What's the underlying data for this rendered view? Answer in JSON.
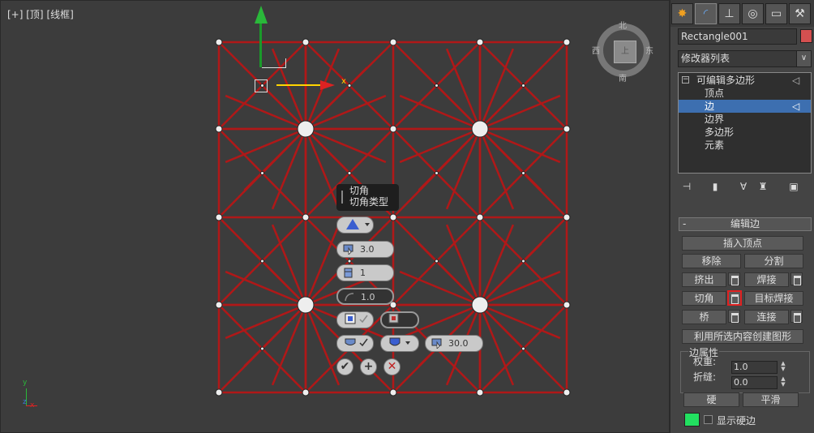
{
  "viewport": {
    "label_plus": "[+]",
    "label_view": "[顶]",
    "label_mode": "[线框]",
    "gizmo_x_label": "x",
    "viewcube": {
      "north": "北",
      "south": "南",
      "east": "东",
      "west": "西",
      "face": "上"
    },
    "tripod": {
      "x": "x",
      "y": "y",
      "z": "z"
    }
  },
  "caddy": {
    "title": "切角",
    "subtitle": "切角类型",
    "amount": "3.0",
    "segments": "1",
    "tension": "1.0",
    "angle": "30.0",
    "ok_icon": "check-icon",
    "apply_icon": "plus-icon",
    "cancel_icon": "cancel-icon"
  },
  "panel": {
    "tabs": [
      "create-icon",
      "modify-icon",
      "hierarchy-icon",
      "motion-icon",
      "display-icon",
      "utilities-icon"
    ],
    "object_name": "Rectangle001",
    "object_color": "#d45050",
    "modifier_list": "修改器列表",
    "stack": {
      "root": "可编辑多边形",
      "items": [
        "顶点",
        "边",
        "边界",
        "多边形",
        "元素"
      ],
      "selected_index": 1
    },
    "edit_edges": {
      "title": "编辑边",
      "collapse": "-",
      "insert_vertex": "插入顶点",
      "remove": "移除",
      "split": "分割",
      "extrude": "挤出",
      "weld": "焊接",
      "chamfer": "切角",
      "target_weld": "目标焊接",
      "bridge": "桥",
      "connect": "连接",
      "create_shape": "利用所选内容创建图形",
      "edge_props": "边属性",
      "weight_label": "权重:",
      "weight_value": "1.0",
      "crease_label": "折缝:",
      "crease_value": "0.0",
      "hard": "硬",
      "smooth": "平滑",
      "show_hard": "显示硬边",
      "hard_color": "#22e060"
    }
  }
}
